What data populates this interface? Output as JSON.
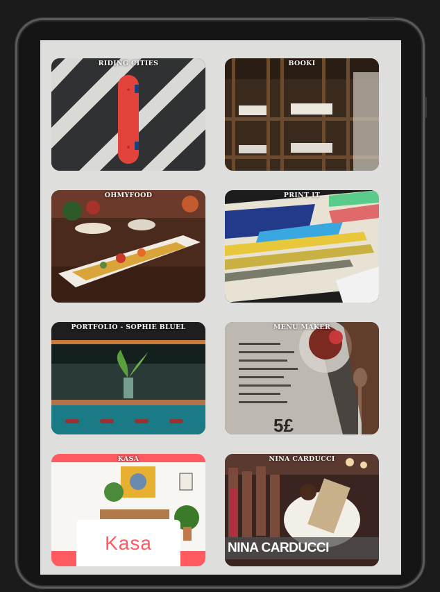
{
  "projects": [
    {
      "title": "RIDING CITIES"
    },
    {
      "title": "BOOKI"
    },
    {
      "title": "OHMYFOOD"
    },
    {
      "title": "PRINT IT"
    },
    {
      "title": "PORTFOLIO - SOPHIE BLUEL"
    },
    {
      "title": "MENU MAKER"
    },
    {
      "title": "KASA",
      "logo_text": "Kasa"
    },
    {
      "title": "NINA CARDUCCI",
      "banner_text": "NINA CARDUCCI"
    }
  ],
  "colors": {
    "screen_bg": "#dededc",
    "kasa_accent": "#ff5a5f",
    "device_frame": "#151515"
  },
  "icons": {
    "camera": "camera-lens-icon"
  }
}
